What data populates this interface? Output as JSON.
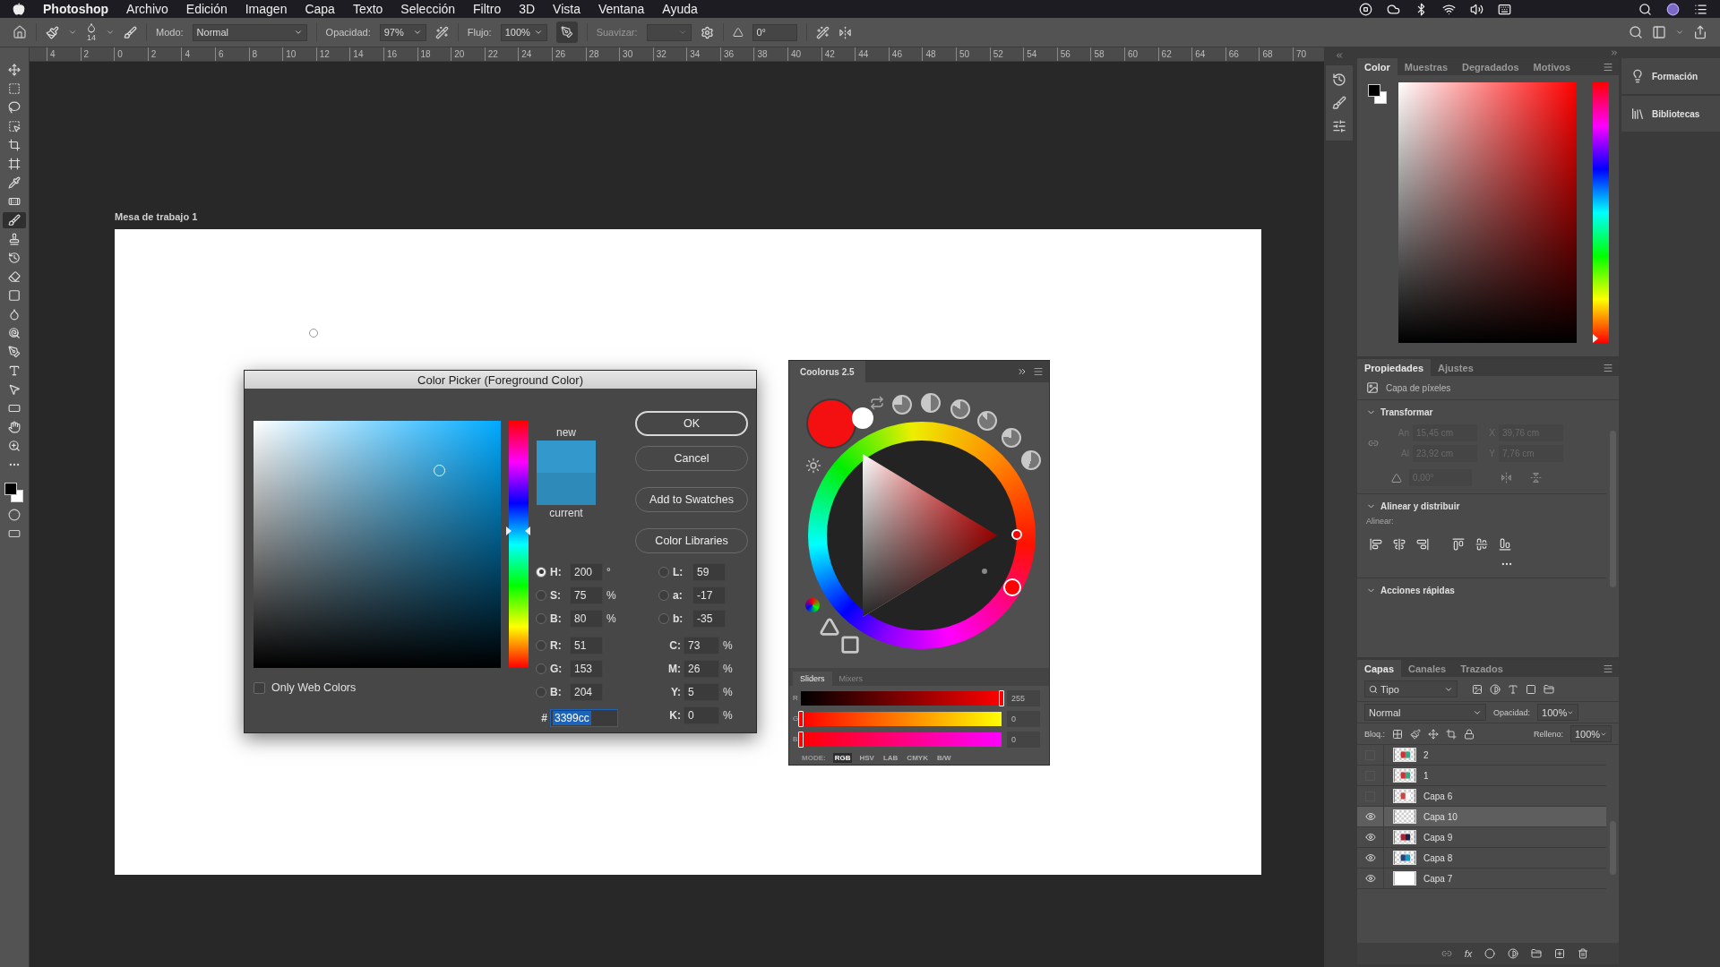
{
  "menu_bar": {
    "app": "Photoshop",
    "items": [
      "Archivo",
      "Edición",
      "Imagen",
      "Capa",
      "Texto",
      "Selección",
      "Filtro",
      "3D",
      "Vista",
      "Ventana",
      "Ayuda"
    ]
  },
  "options_bar": {
    "brush_size": "14",
    "mode_label": "Modo:",
    "mode": "Normal",
    "opacity_label": "Opacidad:",
    "opacity": "97%",
    "flow_label": "Flujo:",
    "flow": "100%",
    "airbrush": true,
    "smoothing_label": "Suavizar:",
    "angle": "0°"
  },
  "ruler": {
    "marks": [
      "4",
      "2",
      "0",
      "2",
      "4",
      "6",
      "8",
      "10",
      "12",
      "14",
      "16",
      "18",
      "20",
      "22",
      "24",
      "26",
      "28",
      "30",
      "32",
      "34",
      "36",
      "38",
      "40",
      "42",
      "44",
      "46",
      "48",
      "50",
      "52",
      "54",
      "56",
      "58",
      "60",
      "62",
      "64",
      "66",
      "68",
      "70"
    ]
  },
  "toolbar": {
    "tools": [
      {
        "selected": false
      },
      {
        "selected": false
      },
      {
        "selected": false
      },
      {
        "selected": false
      },
      {
        "selected": false
      },
      {
        "selected": false
      },
      {
        "selected": false
      },
      {
        "selected": false
      },
      {
        "selected": true
      },
      {
        "selected": false
      },
      {
        "selected": false
      },
      {
        "selected": false
      },
      {
        "selected": false
      },
      {
        "selected": false
      },
      {
        "selected": false
      },
      {
        "selected": false
      },
      {
        "selected": false
      },
      {
        "selected": false
      },
      {
        "selected": false
      },
      {
        "selected": false
      },
      {
        "selected": false
      },
      {
        "selected": false
      }
    ]
  },
  "document": {
    "artboard_label": "Mesa de trabajo 1"
  },
  "color_picker": {
    "title": "Color Picker (Foreground Color)",
    "new_label": "new",
    "current_label": "current",
    "hue_slider": {
      "level": 0.556
    },
    "buttons": [
      {
        "label": "OK",
        "default": true
      },
      {
        "label": "Cancel",
        "default": false
      },
      {
        "label": "Add to Swatches",
        "default": false
      },
      {
        "label": "Color Libraries",
        "default": false
      }
    ],
    "hsb": [
      {
        "label": "H:",
        "value": "200",
        "unit": "°",
        "selected": true
      },
      {
        "label": "S:",
        "value": "75",
        "unit": "%",
        "selected": false
      },
      {
        "label": "B:",
        "value": "80",
        "unit": "%",
        "selected": false
      }
    ],
    "rgb": [
      {
        "label": "R:",
        "value": "51",
        "selected": false
      },
      {
        "label": "G:",
        "value": "153",
        "selected": false
      },
      {
        "label": "B:",
        "value": "204",
        "selected": false
      }
    ],
    "lab": [
      {
        "label": "L:",
        "value": "59",
        "selected": false
      },
      {
        "label": "a:",
        "value": "-17",
        "selected": false
      },
      {
        "label": "b:",
        "value": "-35",
        "selected": false
      }
    ],
    "cmyk": [
      {
        "label": "C:",
        "value": "73",
        "unit": "%"
      },
      {
        "label": "M:",
        "value": "26",
        "unit": "%"
      },
      {
        "label": "Y:",
        "value": "5",
        "unit": "%"
      },
      {
        "label": "K:",
        "value": "0",
        "unit": "%"
      }
    ],
    "hex_label": "#",
    "hex": "3399cc",
    "only_web_colors": {
      "label": "Only Web Colors",
      "checked": false
    }
  },
  "coolorus": {
    "title": "Coolorus 2.5",
    "tabs": [
      {
        "label": "Sliders",
        "selected": true
      },
      {
        "label": "Mixers",
        "selected": false
      }
    ],
    "sliders": [
      {
        "channel": "R",
        "value": "255",
        "level": 1
      },
      {
        "channel": "G",
        "value": "0",
        "level": 0
      },
      {
        "channel": "B",
        "value": "0",
        "level": 0
      }
    ],
    "mode_label": "MODE:",
    "modes": [
      {
        "label": "RGB",
        "selected": true
      },
      {
        "label": "HSV",
        "selected": false
      },
      {
        "label": "LAB",
        "selected": false
      },
      {
        "label": "CMYK",
        "selected": false
      },
      {
        "label": "B/W",
        "selected": false
      }
    ]
  },
  "color_panel": {
    "tabs": [
      {
        "label": "Color",
        "selected": true
      },
      {
        "label": "Muestras",
        "selected": false
      },
      {
        "label": "Degradados",
        "selected": false
      },
      {
        "label": "Motivos",
        "selected": false
      }
    ],
    "hue_slider": {
      "level": 0
    }
  },
  "properties_panel": {
    "tabs": [
      {
        "label": "Propiedades",
        "selected": true
      },
      {
        "label": "Ajustes",
        "selected": false
      }
    ],
    "layer_kind": "Capa de píxeles",
    "transform_title": "Transformar",
    "transform_disabled": true,
    "transform_fields": [
      {
        "label": "An",
        "value": "15,45 cm"
      },
      {
        "label": "X",
        "value": "39,76 cm"
      },
      {
        "label": "Al",
        "value": "23,92 cm"
      },
      {
        "label": "Y",
        "value": "7,76 cm"
      }
    ],
    "angle": "0,00°",
    "align_title": "Alinear y distribuir",
    "align_label": "Alinear:",
    "quick_actions_title": "Acciones rápidas"
  },
  "layers_panel": {
    "tabs": [
      {
        "label": "Capas",
        "selected": true
      },
      {
        "label": "Canales",
        "selected": false
      },
      {
        "label": "Trazados",
        "selected": false
      }
    ],
    "filter": "Tipo",
    "blend_mode": "Normal",
    "opacity_label": "Opacidad:",
    "opacity": "100%",
    "lock_label": "Bloq.:",
    "fill_label": "Relleno:",
    "fill": "100%",
    "layers": [
      {
        "name": "2",
        "visible": false,
        "selected": false,
        "kind": "artwork"
      },
      {
        "name": "1",
        "visible": false,
        "selected": false,
        "kind": "artwork"
      },
      {
        "name": "Capa 6",
        "visible": false,
        "selected": false,
        "kind": "artwork"
      },
      {
        "name": "Capa 10",
        "visible": true,
        "selected": true,
        "kind": "empty"
      },
      {
        "name": "Capa 9",
        "visible": true,
        "selected": false,
        "kind": "artwork"
      },
      {
        "name": "Capa 8",
        "visible": true,
        "selected": false,
        "kind": "artwork"
      },
      {
        "name": "Capa 7",
        "visible": true,
        "selected": false,
        "kind": "white"
      }
    ],
    "fx_label": "fx"
  },
  "side_panel": {
    "items": [
      "Formación",
      "Bibliotecas"
    ]
  }
}
